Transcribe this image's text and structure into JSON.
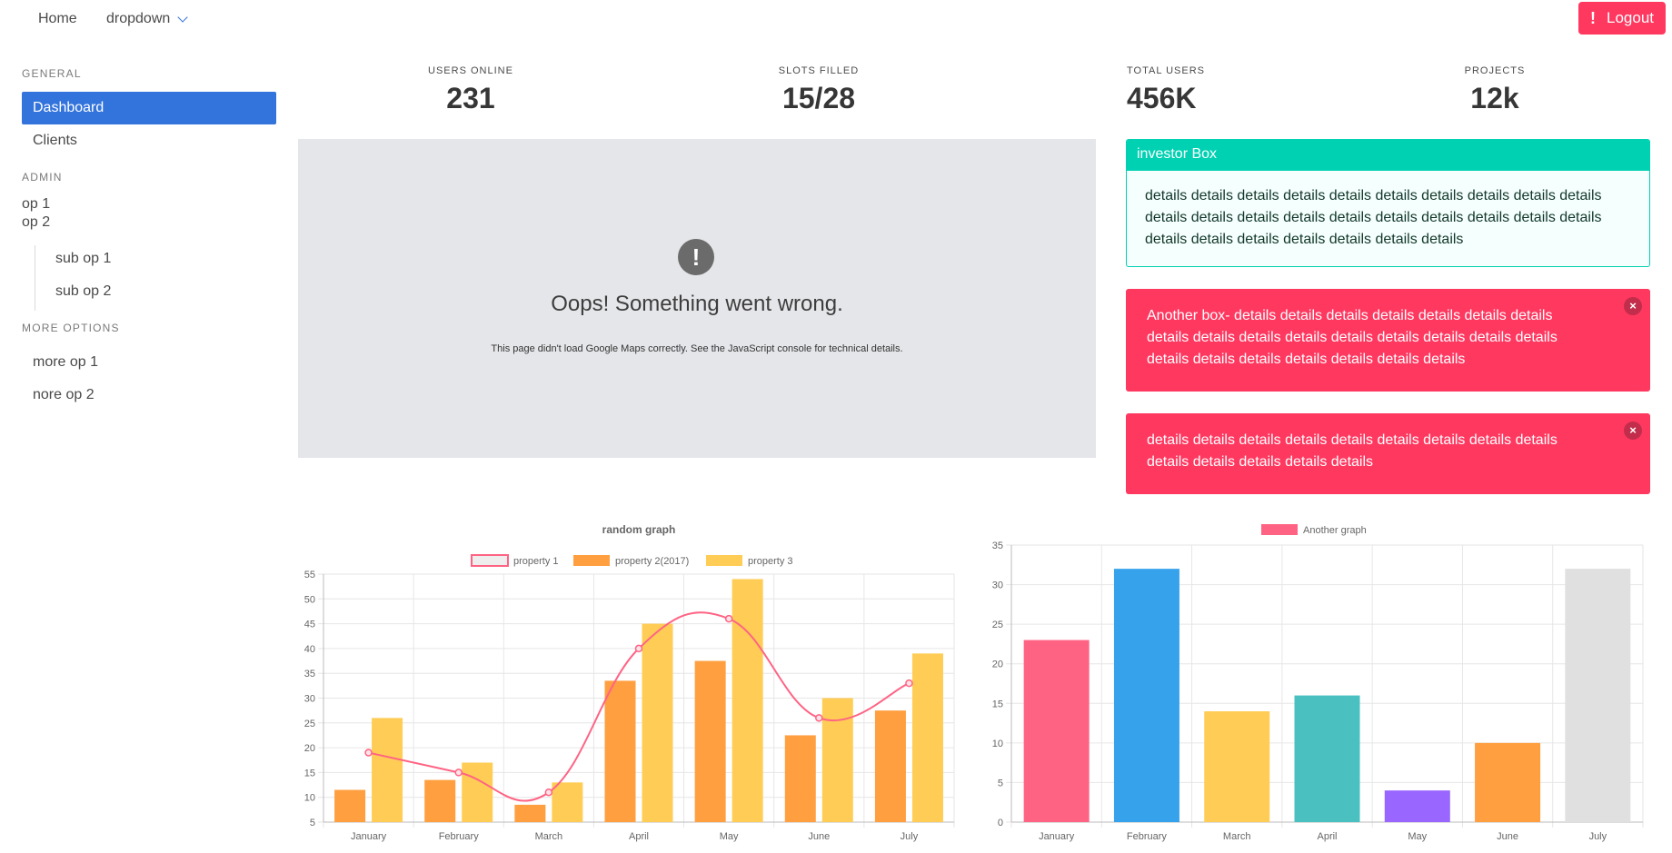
{
  "navbar": {
    "home": "Home",
    "dropdown": "dropdown",
    "logout": "Logout",
    "logout_icon": "!"
  },
  "sidebar": {
    "general_label": "GENERAL",
    "dashboard": "Dashboard",
    "clients": "Clients",
    "admin_label": "ADMIN",
    "op1": "op 1",
    "op2": "op 2",
    "sub_op1": "sub op 1",
    "sub_op2": "sub op 2",
    "more_label": "MORE OPTIONS",
    "more_op1": "more op 1",
    "more_op2": "nore op 2"
  },
  "stats": [
    {
      "heading": "USERS ONLINE",
      "value": "231"
    },
    {
      "heading": "SLOTS FILLED",
      "value": "15/28"
    },
    {
      "heading": "TOTAL USERS",
      "value": "456K"
    },
    {
      "heading": "PROJECTS",
      "value": "12k"
    }
  ],
  "map_error": {
    "icon": "!",
    "title": "Oops! Something went wrong.",
    "text": "This page didn't load Google Maps correctly. See the JavaScript console for technical details."
  },
  "investor_box": {
    "title": "investor Box",
    "body": "details details details details details details details details details details details details details details details details details details details details details details details details details details details"
  },
  "alert_boxes": [
    {
      "text": "Another box- details details details details details details details details details details details details details details details details details details details details details details details"
    },
    {
      "text": "details details details details details details details details details details details details details details"
    }
  ],
  "colors": {
    "primary": "#3273dc",
    "danger": "#ff3860",
    "success": "#00d1b2"
  },
  "chart_data": [
    {
      "type": "bar",
      "title": "random graph",
      "categories": [
        "January",
        "February",
        "March",
        "April",
        "May",
        "June",
        "July"
      ],
      "ylim": [
        5,
        55
      ],
      "yticks": [
        5,
        10,
        15,
        20,
        25,
        30,
        35,
        40,
        45,
        50,
        55
      ],
      "legend": "top",
      "grid": true,
      "series": [
        {
          "name": "property 1",
          "type": "line",
          "color": "#ff6384",
          "values": [
            19,
            15,
            11,
            40,
            46,
            26,
            33
          ]
        },
        {
          "name": "property 2(2017)",
          "type": "bar",
          "color": "#ff9f40",
          "values": [
            11.5,
            13.5,
            8.5,
            33.5,
            37.5,
            22.5,
            27.5
          ]
        },
        {
          "name": "property 3",
          "type": "bar",
          "color": "#ffcd56",
          "values": [
            26,
            17,
            13,
            45,
            54,
            30,
            39
          ]
        }
      ]
    },
    {
      "type": "bar",
      "title": "",
      "categories": [
        "January",
        "February",
        "March",
        "April",
        "May",
        "June",
        "July"
      ],
      "ylim": [
        0,
        35
      ],
      "yticks": [
        0,
        5,
        10,
        15,
        20,
        25,
        30,
        35
      ],
      "legend": "top",
      "grid": true,
      "series": [
        {
          "name": "Another graph",
          "values": [
            23,
            32,
            14,
            16,
            4,
            10,
            32
          ],
          "colors": [
            "#ff6384",
            "#36a2eb",
            "#ffcd56",
            "#4bc0c0",
            "#9966ff",
            "#ff9f40",
            "#e0e0e0"
          ]
        }
      ]
    }
  ]
}
